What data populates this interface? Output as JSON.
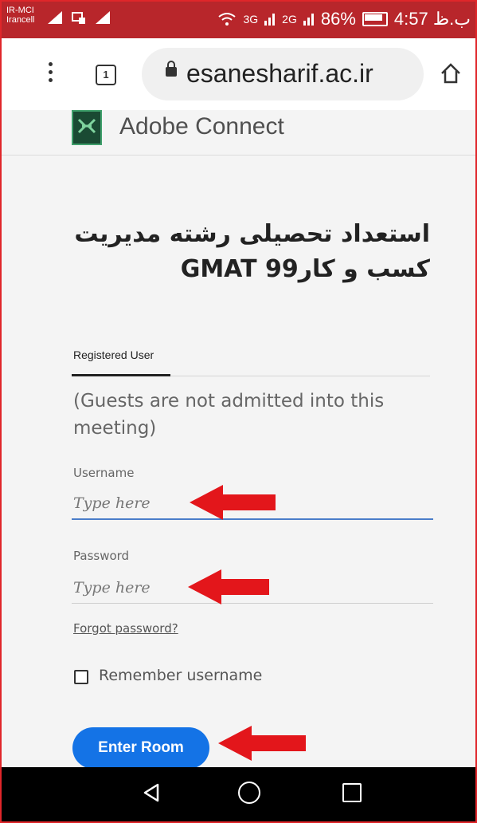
{
  "status_bar": {
    "carrier_1": "IR-MCI",
    "carrier_2": "Irancell",
    "network_1": "3G",
    "network_2": "2G",
    "battery": "86%",
    "time": "ب.ظ 4:57"
  },
  "browser": {
    "url": "esanesharif.ac.ir",
    "tab_count": "1"
  },
  "app": {
    "title": "Adobe Connect",
    "logo_color": "#1a4a33"
  },
  "meeting": {
    "title": "استعداد تحصیلی رشته مدیریت کسب و کار99 GMAT"
  },
  "login": {
    "tab_label": "Registered User",
    "guest_note": "(Guests are not admitted into this meeting)",
    "username_label": "Username",
    "username_placeholder": "Type here",
    "password_label": "Password",
    "password_placeholder": "Type here",
    "forgot_label": "Forgot password?",
    "remember_label": "Remember username",
    "remember_checked": false,
    "enter_label": "Enter Room"
  },
  "colors": {
    "accent": "#1473e6",
    "annotation_arrow": "#e3161b",
    "status_bar": "#b8262b"
  }
}
